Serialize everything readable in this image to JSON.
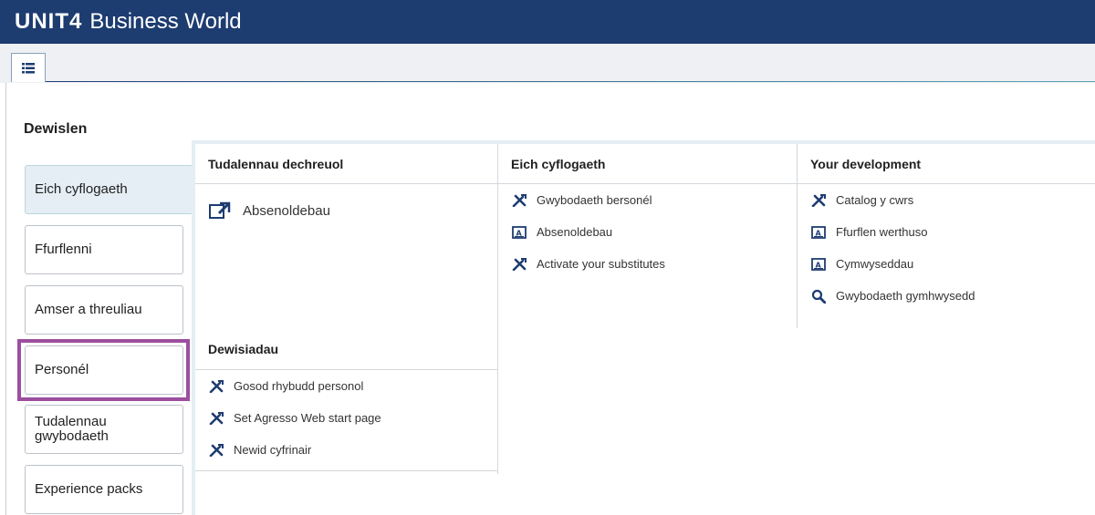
{
  "header": {
    "logo": "UNIT4",
    "product": "Business World"
  },
  "tabstrip": {
    "menu_icon": "list-icon"
  },
  "page": {
    "title": "Dewislen"
  },
  "sidebar": {
    "items": [
      {
        "label": "Eich cyflogaeth",
        "active": true
      },
      {
        "label": "Ffurflenni"
      },
      {
        "label": "Amser a threuliau"
      },
      {
        "label": "Personél",
        "highlighted": true
      },
      {
        "label": "Tudalennau gwybodaeth"
      },
      {
        "label": "Experience packs"
      }
    ]
  },
  "groups": {
    "start_pages": {
      "title": "Tudalennau dechreuol",
      "items": [
        {
          "label": "Absenoldebau",
          "icon": "external-link-icon"
        }
      ]
    },
    "employment": {
      "title": "Eich cyflogaeth",
      "items": [
        {
          "label": "Gwybodaeth bersonél",
          "icon": "tools-icon"
        },
        {
          "label": "Absenoldebau",
          "icon": "form-icon"
        },
        {
          "label": "Activate your substitutes",
          "icon": "tools-icon"
        }
      ]
    },
    "development": {
      "title": "Your development",
      "items": [
        {
          "label": "Catalog y cwrs",
          "icon": "tools-icon"
        },
        {
          "label": "Ffurflen werthuso",
          "icon": "form-icon"
        },
        {
          "label": "Cymwyseddau",
          "icon": "form-icon"
        },
        {
          "label": "Gwybodaeth gymhwysedd",
          "icon": "search-icon"
        }
      ]
    },
    "options": {
      "title": "Dewisiadau",
      "items": [
        {
          "label": "Gosod rhybudd personol",
          "icon": "tools-icon"
        },
        {
          "label": "Set Agresso Web start page",
          "icon": "tools-icon"
        },
        {
          "label": "Newid cyfrinair",
          "icon": "tools-icon"
        }
      ]
    }
  },
  "colors": {
    "header_bg": "#1d3c70",
    "active_bg": "#e4eef4",
    "highlight": "#9b4f9e",
    "icon": "#1d3c70"
  }
}
